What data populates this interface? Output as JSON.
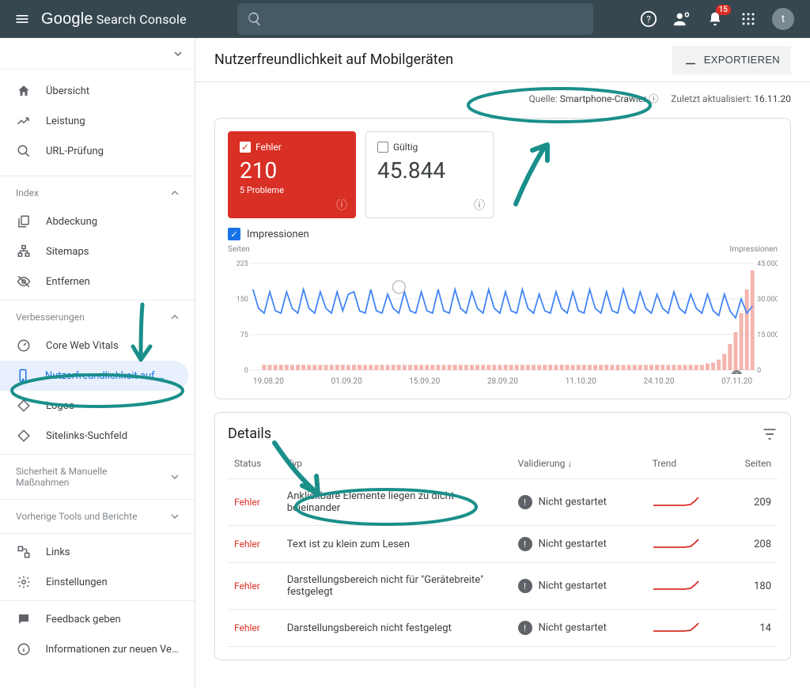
{
  "header": {
    "logo_google": "Google",
    "logo_product": "Search Console",
    "notification_count": "15",
    "avatar_letter": "t"
  },
  "sidebar": {
    "overview": "Übersicht",
    "performance": "Leistung",
    "url_inspect": "URL-Prüfung",
    "index_label": "Index",
    "coverage": "Abdeckung",
    "sitemaps": "Sitemaps",
    "removals": "Entfernen",
    "enhancements_label": "Verbesserungen",
    "core_web_vitals": "Core Web Vitals",
    "mobile_usability": "Nutzerfreundlichkeit auf Mo...",
    "logos": "Logos",
    "sitelinks": "Sitelinks-Suchfeld",
    "security_label": "Sicherheit & Manuelle Maßnahmen",
    "legacy_label": "Vorherige Tools und Berichte",
    "links": "Links",
    "settings": "Einstellungen",
    "feedback": "Feedback geben",
    "new_version": "Informationen zur neuen Ver..."
  },
  "page": {
    "title": "Nutzerfreundlichkeit auf Mobilgeräten",
    "export_label": "EXPORTIEREN",
    "source_label": "Quelle:",
    "source_value": "Smartphone-Crawler",
    "updated_label": "Zuletzt aktualisiert:",
    "updated_value": "16.11.20"
  },
  "stats": {
    "error_label": "Fehler",
    "error_value": "210",
    "error_sub": "5 Probleme",
    "valid_label": "Gültig",
    "valid_value": "45.844",
    "impressions_label": "Impressionen"
  },
  "chart": {
    "left_axis_label": "Seiten",
    "right_axis_label": "Impressionen",
    "left_ticks": [
      "225",
      "150",
      "75",
      "0"
    ],
    "right_ticks": [
      "45.000",
      "30.000",
      "15.000",
      "0"
    ],
    "x_ticks": [
      "19.08.20",
      "01.09.20",
      "15.09.20",
      "28.09.20",
      "11.10.20",
      "24.10.20",
      "07.11.20"
    ]
  },
  "chart_data": {
    "type": "line",
    "xlabel": "",
    "ylabel_left": "Seiten",
    "ylabel_right": "Impressionen",
    "ylim_left": [
      0,
      225
    ],
    "ylim_right": [
      0,
      45000
    ],
    "x_start": "19.08.20",
    "x_end": "16.11.20",
    "series": [
      {
        "name": "Fehler (Seiten)",
        "axis": "left",
        "type": "bar",
        "values": [
          0,
          0,
          11,
          11,
          11,
          11,
          11,
          11,
          11,
          11,
          11,
          11,
          11,
          11,
          11,
          11,
          11,
          11,
          11,
          11,
          11,
          11,
          11,
          11,
          11,
          11,
          11,
          11,
          11,
          11,
          11,
          11,
          11,
          11,
          11,
          11,
          11,
          11,
          11,
          11,
          11,
          11,
          11,
          11,
          11,
          11,
          11,
          11,
          11,
          11,
          11,
          11,
          11,
          11,
          11,
          11,
          11,
          11,
          11,
          11,
          11,
          11,
          11,
          11,
          11,
          11,
          11,
          11,
          11,
          11,
          11,
          11,
          11,
          11,
          11,
          11,
          11,
          11,
          11,
          11,
          11,
          14,
          16,
          22,
          34,
          55,
          80,
          120,
          170,
          210
        ]
      },
      {
        "name": "Impressionen",
        "axis": "right",
        "type": "line",
        "values": [
          34000,
          26000,
          24000,
          33000,
          25000,
          24000,
          33000,
          26000,
          24000,
          34000,
          26000,
          24000,
          33000,
          26000,
          24000,
          33000,
          25000,
          32000,
          33000,
          25000,
          24000,
          34000,
          25000,
          24000,
          32000,
          26000,
          24000,
          33000,
          25000,
          24000,
          33000,
          25000,
          24000,
          34000,
          25000,
          24000,
          34000,
          26000,
          24000,
          33000,
          26000,
          24000,
          34000,
          26000,
          24000,
          33000,
          25000,
          24000,
          34000,
          26000,
          24000,
          32000,
          25000,
          24000,
          33000,
          26000,
          24000,
          33000,
          25000,
          24000,
          34000,
          26000,
          24000,
          33000,
          25000,
          24000,
          34000,
          26000,
          24000,
          33000,
          26000,
          24000,
          32000,
          26000,
          24000,
          33000,
          26000,
          24000,
          32000,
          26000,
          24000,
          32000,
          25000,
          23000,
          32000,
          25000,
          22000,
          30000,
          24000,
          27000
        ]
      }
    ]
  },
  "details": {
    "title": "Details",
    "columns": {
      "status": "Status",
      "type": "Typ",
      "validation": "Validierung",
      "trend": "Trend",
      "pages": "Seiten"
    },
    "rows": [
      {
        "status": "Fehler",
        "type": "Anklickbare Elemente liegen zu dicht beieinander",
        "validation": "Nicht gestartet",
        "pages": "209"
      },
      {
        "status": "Fehler",
        "type": "Text ist zu klein zum Lesen",
        "validation": "Nicht gestartet",
        "pages": "208"
      },
      {
        "status": "Fehler",
        "type": "Darstellungsbereich nicht für \"Gerätebreite\" festgelegt",
        "validation": "Nicht gestartet",
        "pages": "180"
      },
      {
        "status": "Fehler",
        "type": "Darstellungsbereich nicht festgelegt",
        "validation": "Nicht gestartet",
        "pages": "14"
      }
    ]
  }
}
